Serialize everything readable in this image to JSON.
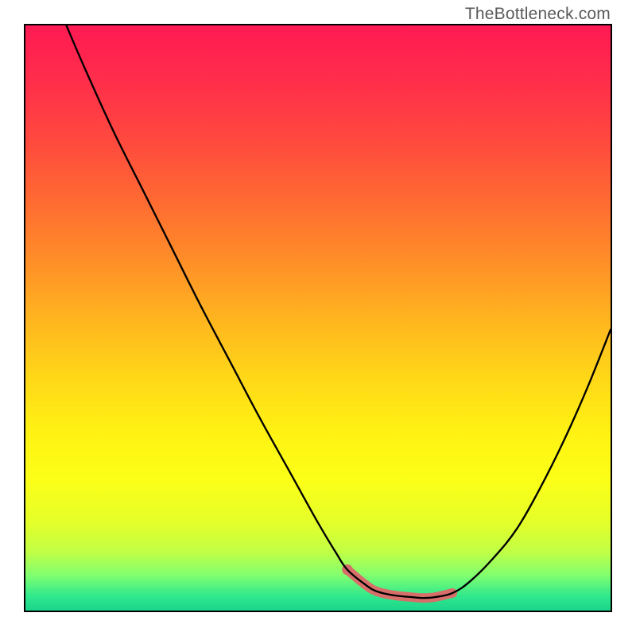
{
  "watermark": "TheBottleneck.com",
  "gradient_stops": [
    {
      "offset": 0.0,
      "color": "#ff1a53"
    },
    {
      "offset": 0.1,
      "color": "#ff2f4a"
    },
    {
      "offset": 0.2,
      "color": "#ff4a3e"
    },
    {
      "offset": 0.3,
      "color": "#ff6a32"
    },
    {
      "offset": 0.4,
      "color": "#ff8d28"
    },
    {
      "offset": 0.5,
      "color": "#ffb41f"
    },
    {
      "offset": 0.6,
      "color": "#ffd718"
    },
    {
      "offset": 0.7,
      "color": "#fff313"
    },
    {
      "offset": 0.78,
      "color": "#fbff18"
    },
    {
      "offset": 0.85,
      "color": "#e4ff2a"
    },
    {
      "offset": 0.9,
      "color": "#c0ff45"
    },
    {
      "offset": 0.94,
      "color": "#80ff70"
    },
    {
      "offset": 0.975,
      "color": "#30e88c"
    },
    {
      "offset": 1.0,
      "color": "#1bd58b"
    }
  ],
  "chart_data": {
    "type": "line",
    "title": "",
    "xlabel": "",
    "ylabel": "",
    "xlim": [
      0,
      100
    ],
    "ylim": [
      0,
      100
    ],
    "series": [
      {
        "name": "curve",
        "x": [
          7,
          10,
          15,
          20,
          25,
          30,
          35,
          40,
          45,
          50,
          53,
          55,
          58,
          60,
          63,
          66,
          68,
          70,
          73,
          76,
          80,
          84,
          88,
          92,
          96,
          100
        ],
        "values": [
          100,
          93,
          82,
          72,
          62,
          52,
          42.5,
          33,
          24,
          15,
          10,
          7,
          4.5,
          3.3,
          2.6,
          2.3,
          2.15,
          2.3,
          3,
          5,
          9,
          14,
          21,
          29,
          38,
          48
        ]
      },
      {
        "name": "highlight",
        "x": [
          55,
          58,
          60,
          63,
          66,
          68,
          70,
          73
        ],
        "values": [
          7,
          4.5,
          3.3,
          2.6,
          2.3,
          2.15,
          2.3,
          3
        ]
      }
    ],
    "highlight_color": "#d86e6a",
    "curve_color": "#000000"
  }
}
